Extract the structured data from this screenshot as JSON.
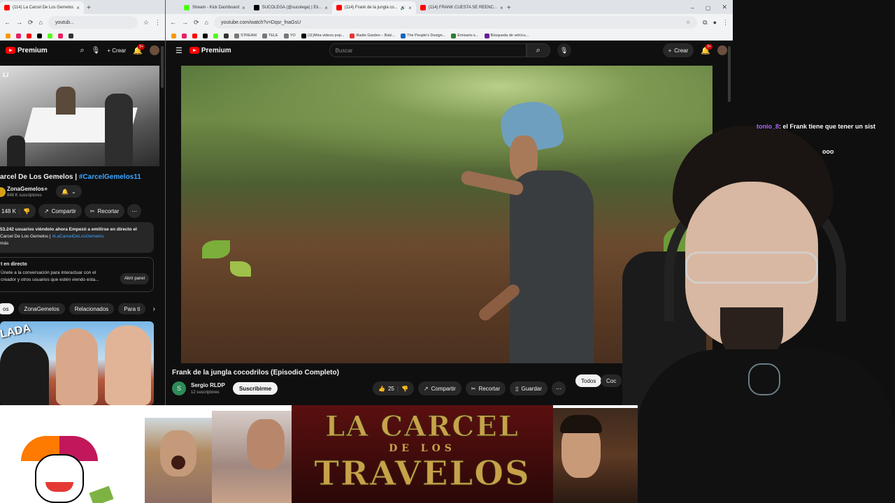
{
  "left_browser": {
    "tabs": [
      {
        "label": "(114) La Carcel De Los Gemelos",
        "active": true
      }
    ],
    "url": "youtub...",
    "yt_logo": "Premium",
    "create_label": "Crear",
    "notif_count": "9+",
    "live_badge": "LIVE",
    "video": {
      "title_visible": "arcel De Los Gemelos | ",
      "hashtag": "#CarcelGemelos11",
      "channel": "ZonaGemelos",
      "subs": "848 K suscriptores",
      "likes": "148 K",
      "share": "Compartir",
      "clip": "Recortar",
      "desc_line1": "53.242 usuarios viéndolo ahora  Empezó a emitirse en directo el",
      "desc_line2": "Carcel De Los Gemelos | ",
      "desc_tag": "#LaCarcelDeLosGemelos",
      "desc_more": "más"
    },
    "chat_box": {
      "title": "t en directo",
      "text": "Únete a la conversación para interactuar con el creador y otros usuarios que estén viendo esta...",
      "button": "Abrir panel"
    },
    "chips": [
      "os",
      "ZonaGemelos",
      "Relacionados",
      "Para ti"
    ],
    "thumb_text": "LADA"
  },
  "right_browser": {
    "tabs": [
      {
        "label": "Stream - Kick Dashboard",
        "color": "#53fc18"
      },
      {
        "label": "SUCOLEGA (@sucolega) | Eli...",
        "color": "#000000"
      },
      {
        "label": "(114) Frank de la jungla co...",
        "color": "#ff0000",
        "active": true
      },
      {
        "label": "(114) FRANK CUESTA SE REENC...",
        "color": "#ff0000"
      }
    ],
    "url": "youtube.com/watch?v=Dqsr_fnaGsU",
    "bookmarks": [
      "STREAM",
      "TELE",
      "YO",
      "(11)Mira videos pop...",
      "Radio Garden – Balz...",
      "The People's Design...",
      "Emisario s...",
      "Búsqueda de vehícu..."
    ],
    "yt_logo": "Premium",
    "search_placeholder": "Buscar",
    "create_label": "Crear",
    "notif_count": "9+",
    "video": {
      "title": "Frank de la jungla cocodrilos (Episodio Completo)",
      "channel": "Sergio RLDP",
      "channel_initial": "S",
      "subs": "12 suscriptores",
      "subscribe": "Suscribirme",
      "likes": "25",
      "share": "Compartir",
      "clip": "Recortar",
      "save": "Guardar"
    },
    "chips": [
      "Todos",
      "Coc"
    ]
  },
  "chat_overlay": {
    "user": "tonio_8",
    "message": ": el Frank tiene que tener un sist",
    "message2": "ooo"
  },
  "banner": {
    "line1": "LA CARCEL",
    "line2": "DE LOS",
    "line3": "TRAVELOS"
  },
  "colors": {
    "yt_red": "#ff0000",
    "link_blue": "#3ea6ff",
    "banner_gold": "#c8a24a"
  }
}
